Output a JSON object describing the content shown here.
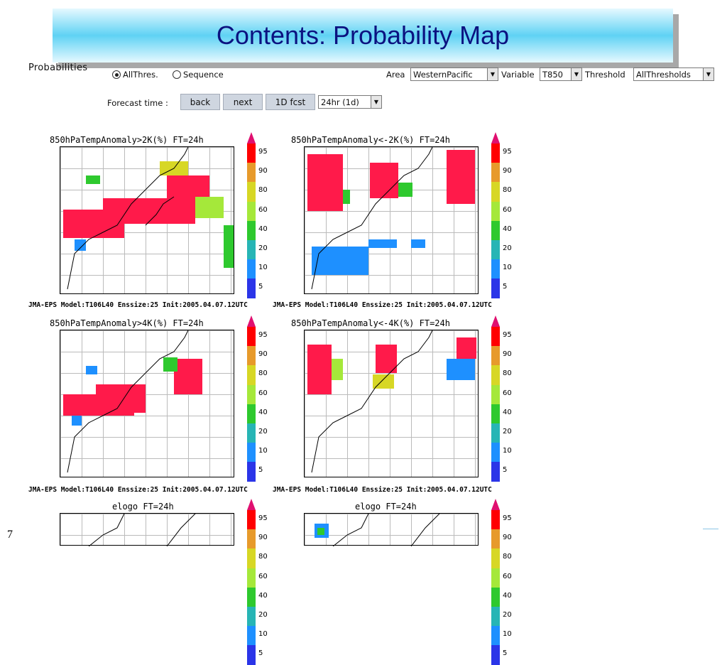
{
  "slide": {
    "title": "Contents: Probability Map",
    "number": "7"
  },
  "form": {
    "probabilities_label": "Probabilities",
    "mode_options": [
      {
        "label": "AllThres.",
        "selected": true
      },
      {
        "label": "Sequence",
        "selected": false
      }
    ],
    "area_label": "Area",
    "area_value": "WesternPacific",
    "variable_label": "Variable",
    "variable_value": "T850",
    "threshold_label": "Threshold",
    "threshold_value": "AllThresholds",
    "forecast_time_label": "Forecast time :",
    "back_label": "back",
    "next_label": "next",
    "fcst_label": "1D fcst",
    "forecast_value": "24hr (1d)"
  },
  "legend": {
    "levels": [
      "95",
      "90",
      "80",
      "60",
      "40",
      "20",
      "10",
      "5"
    ],
    "colors": [
      "#ff0000",
      "#e79a2b",
      "#d7d725",
      "#a5e83a",
      "#2ec92e",
      "#27b5b5",
      "#1e90ff",
      "#2b35e8"
    ],
    "tip_color": "#e01070"
  },
  "maps": [
    {
      "title": "850hPaTempAnomaly>2K(%) FT=24h",
      "caption": "JMA-EPS Model:T106L40 Enssize:25 Init:2005.04.07.12UTC"
    },
    {
      "title": "850hPaTempAnomaly<-2K(%) FT=24h",
      "caption": "JMA-EPS Model:T106L40 Enssize:25 Init:2005.04.07.12UTC"
    },
    {
      "title": "850hPaTempAnomaly>4K(%) FT=24h",
      "caption": "JMA-EPS Model:T106L40 Enssize:25 Init:2005.04.07.12UTC"
    },
    {
      "title": "850hPaTempAnomaly<-4K(%) FT=24h",
      "caption": "JMA-EPS Model:T106L40 Enssize:25 Init:2005.04.07.12UTC"
    },
    {
      "title": "elogo FT=24h",
      "caption": ""
    },
    {
      "title": "elogo FT=24h",
      "caption": ""
    }
  ]
}
